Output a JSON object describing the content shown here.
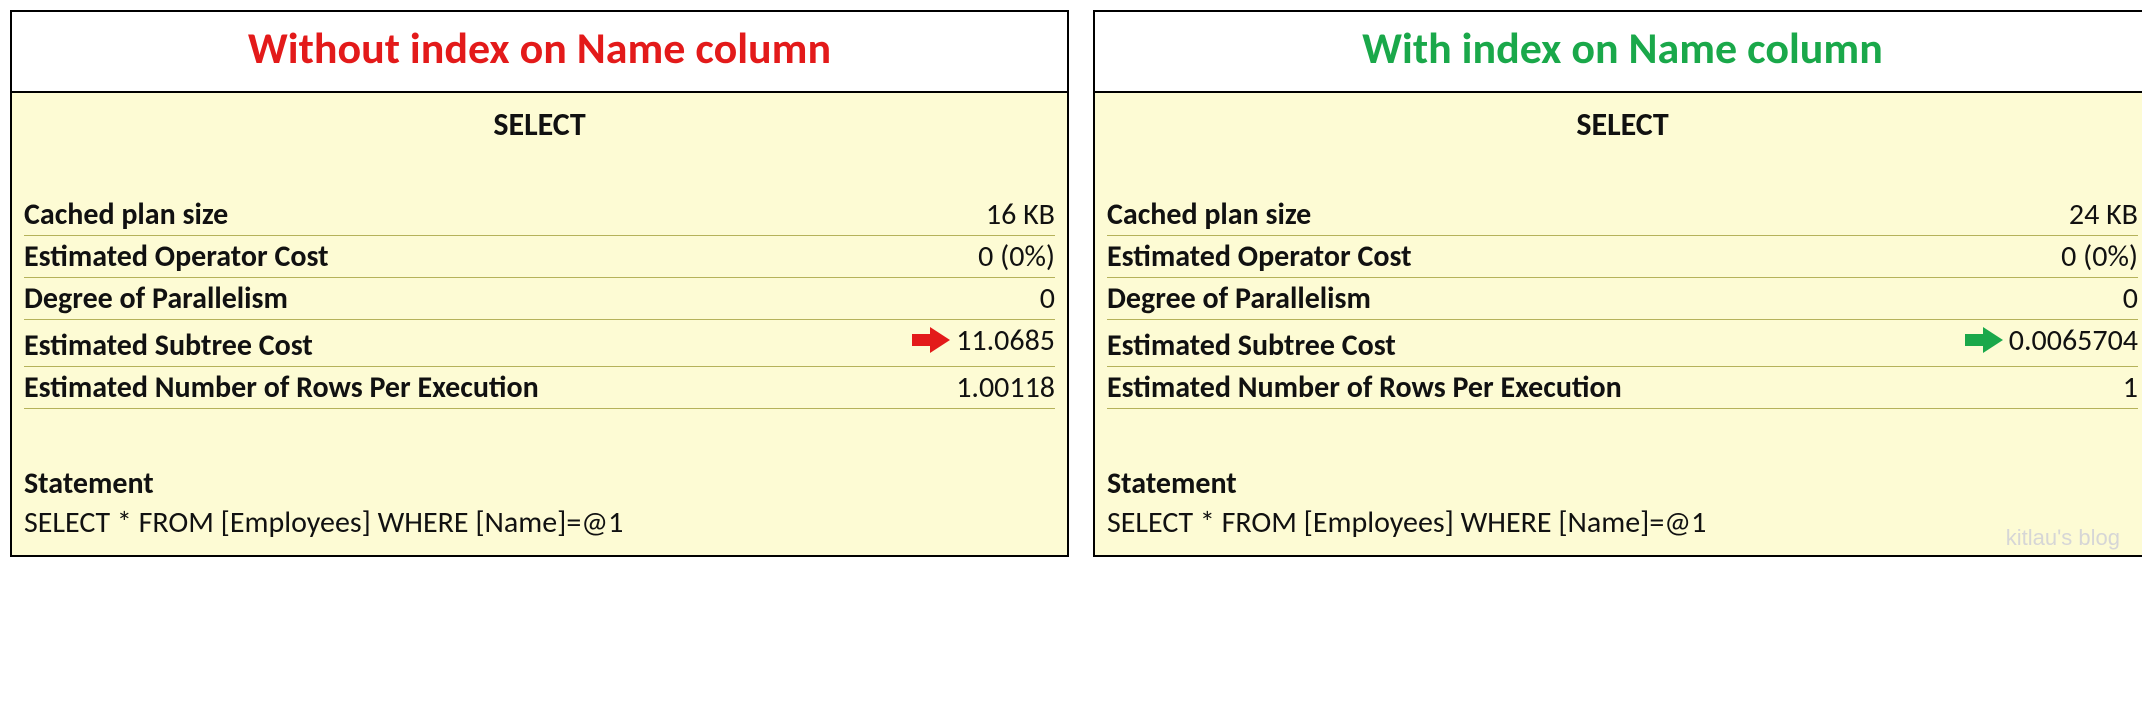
{
  "watermark": "kitlau's blog",
  "arrow_colors": {
    "red": "#e31a1a",
    "green": "#1aa84a"
  },
  "left": {
    "title": "Without index on Name column",
    "operator": "SELECT",
    "rows": [
      {
        "label": "Cached plan size",
        "value": "16 KB",
        "highlight": false
      },
      {
        "label": "Estimated Operator Cost",
        "value": "0 (0%)",
        "highlight": false
      },
      {
        "label": "Degree of Parallelism",
        "value": "0",
        "highlight": false
      },
      {
        "label": "Estimated Subtree Cost",
        "value": "11.0685",
        "highlight": true
      },
      {
        "label": "Estimated Number of Rows Per Execution",
        "value": "1.00118",
        "highlight": false
      }
    ],
    "statement_label": "Statement",
    "statement_text": "SELECT * FROM [Employees] WHERE [Name]=@1"
  },
  "right": {
    "title": "With index on Name column",
    "operator": "SELECT",
    "rows": [
      {
        "label": "Cached plan size",
        "value": "24 KB",
        "highlight": false
      },
      {
        "label": "Estimated Operator Cost",
        "value": "0 (0%)",
        "highlight": false
      },
      {
        "label": "Degree of Parallelism",
        "value": "0",
        "highlight": false
      },
      {
        "label": "Estimated Subtree Cost",
        "value": "0.0065704",
        "highlight": true
      },
      {
        "label": "Estimated Number of Rows Per Execution",
        "value": "1",
        "highlight": false
      }
    ],
    "statement_label": "Statement",
    "statement_text": "SELECT * FROM [Employees] WHERE [Name]=@1"
  }
}
